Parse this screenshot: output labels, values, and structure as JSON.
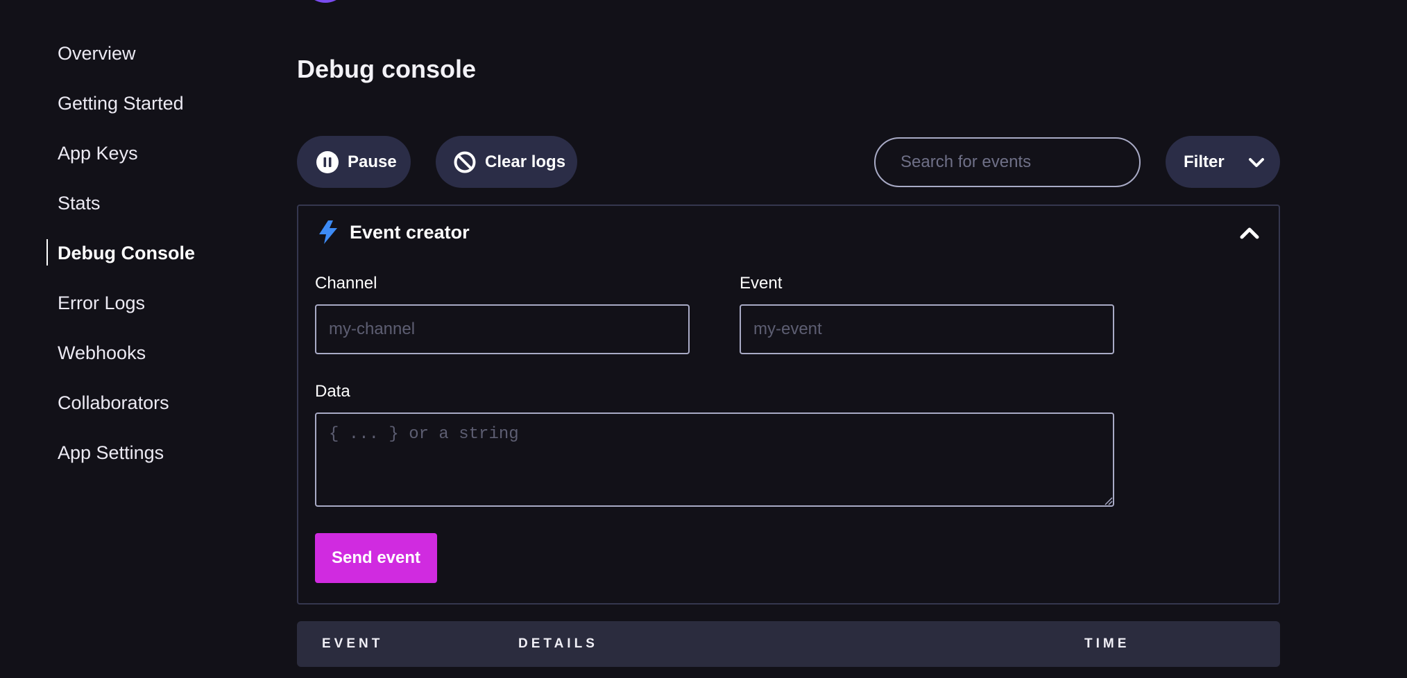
{
  "sidebar": {
    "items": [
      {
        "label": "Overview"
      },
      {
        "label": "Getting Started"
      },
      {
        "label": "App Keys"
      },
      {
        "label": "Stats"
      },
      {
        "label": "Debug Console",
        "active": true
      },
      {
        "label": "Error Logs"
      },
      {
        "label": "Webhooks"
      },
      {
        "label": "Collaborators"
      },
      {
        "label": "App Settings"
      }
    ]
  },
  "main": {
    "title": "Debug console",
    "toolbar": {
      "pause_label": "Pause",
      "pause_icon": "pause-icon",
      "clear_label": "Clear logs",
      "clear_icon": "block-icon",
      "search_placeholder": "Search for events",
      "filter_label": "Filter",
      "filter_icon": "chevron-down-icon"
    },
    "event_creator": {
      "title": "Event creator",
      "icon": "bolt-icon",
      "collapse_icon": "chevron-up-icon",
      "channel_label": "Channel",
      "channel_placeholder": "my-channel",
      "channel_value": "",
      "event_label": "Event",
      "event_placeholder": "my-event",
      "event_value": "",
      "data_label": "Data",
      "data_placeholder": "{ ... } or a string",
      "data_value": "",
      "send_label": "Send event"
    },
    "table": {
      "columns": [
        "EVENT",
        "DETAILS",
        "TIME"
      ]
    }
  },
  "colors": {
    "background": "#121118",
    "button_bg": "#2b2d47",
    "accent_send": "#d02be0",
    "bolt": "#3d8bf5",
    "avatar": "#7a4cf0"
  }
}
